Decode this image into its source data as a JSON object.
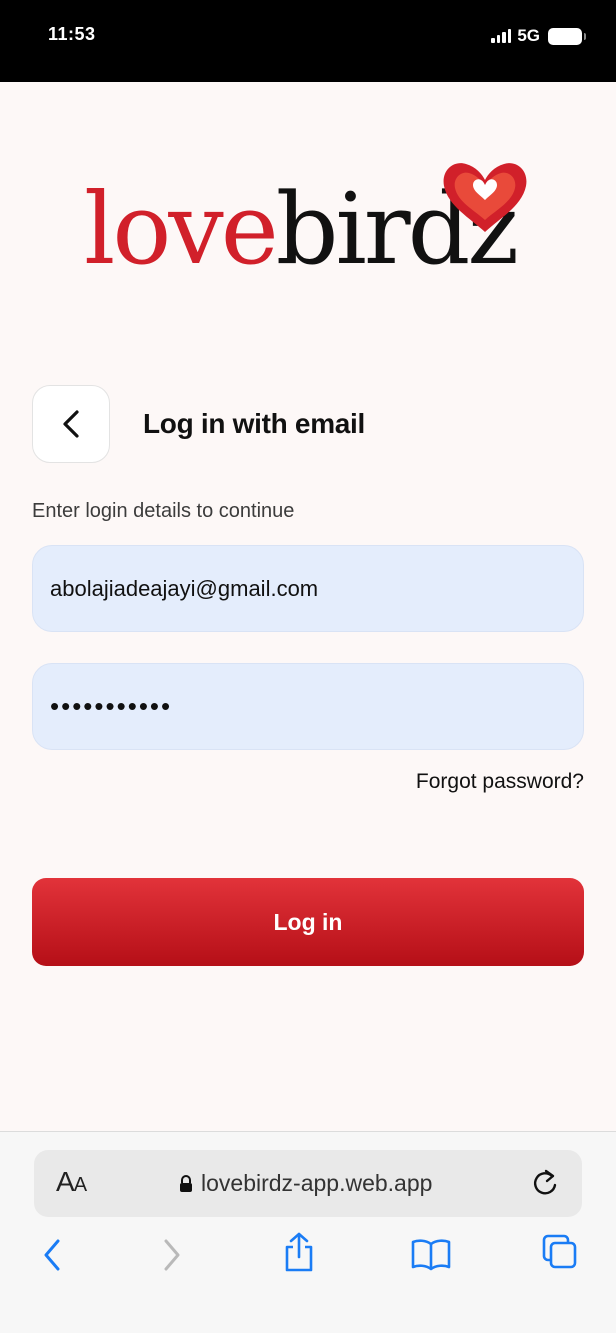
{
  "status_bar": {
    "time": "11:53",
    "network": "5G"
  },
  "logo": {
    "part1": "love",
    "part2": "birdz"
  },
  "header": {
    "title": "Log in with email"
  },
  "form": {
    "subtitle": "Enter login details to continue",
    "email_value": "abolajiadeajayi@gmail.com",
    "password_value": "•••••••••••",
    "forgot_label": "Forgot password?",
    "submit_label": "Log in"
  },
  "browser": {
    "aa_label_big": "A",
    "aa_label_small": "A",
    "url": "lovebirdz-app.web.app"
  },
  "colors": {
    "brand_red": "#d1202a",
    "input_bg": "#e4edfc",
    "ios_blue": "#1a7cf5"
  }
}
